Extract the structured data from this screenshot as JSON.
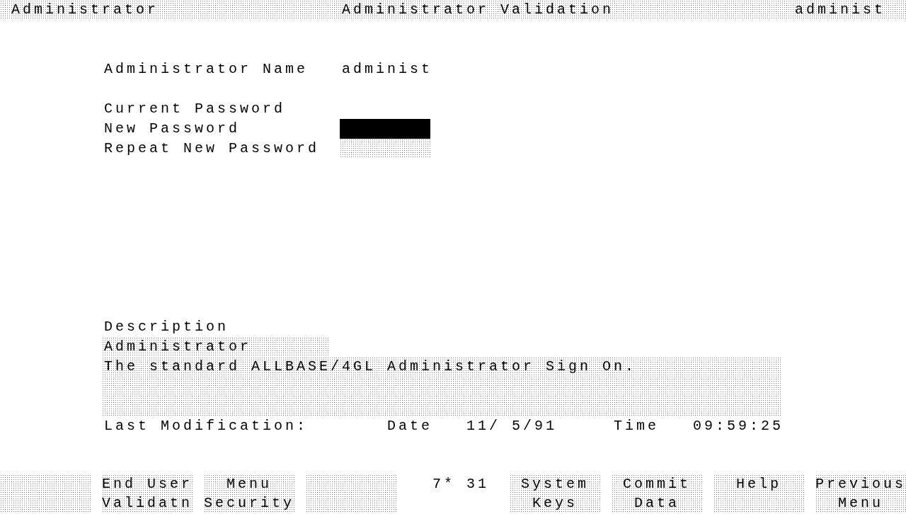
{
  "header": {
    "left": "Administrator",
    "title": "Administrator Validation",
    "right": "administ"
  },
  "admin_name": {
    "label": "Administrator Name",
    "value": "administ"
  },
  "passwords": [
    {
      "label": "Current Password"
    },
    {
      "label": "New Password",
      "field": {
        "focused": true
      }
    },
    {
      "label": "Repeat New Password",
      "field": {
        "focused": false
      }
    }
  ],
  "description": {
    "label": "Description",
    "name": "Administrator",
    "text": "The standard ALLBASE/4GL Administrator Sign On."
  },
  "last_modification": {
    "label": "Last Modification:",
    "date_label": "Date",
    "date": "11/ 5/91",
    "time_label": "Time",
    "time": "09:59:25"
  },
  "function_keys": [
    {
      "kind": "blank"
    },
    {
      "kind": "key",
      "lines": [
        "End User",
        "Validatn"
      ]
    },
    {
      "kind": "key",
      "lines": [
        "Menu",
        "Security"
      ]
    },
    {
      "kind": "blank"
    },
    {
      "kind": "counter",
      "text": "7* 31"
    },
    {
      "kind": "key",
      "lines": [
        "System",
        "Keys"
      ]
    },
    {
      "kind": "key",
      "lines": [
        "Commit",
        "Data"
      ]
    },
    {
      "kind": "key",
      "lines": [
        "Help"
      ]
    },
    {
      "kind": "key",
      "lines": [
        "Previous",
        "Menu"
      ]
    }
  ]
}
